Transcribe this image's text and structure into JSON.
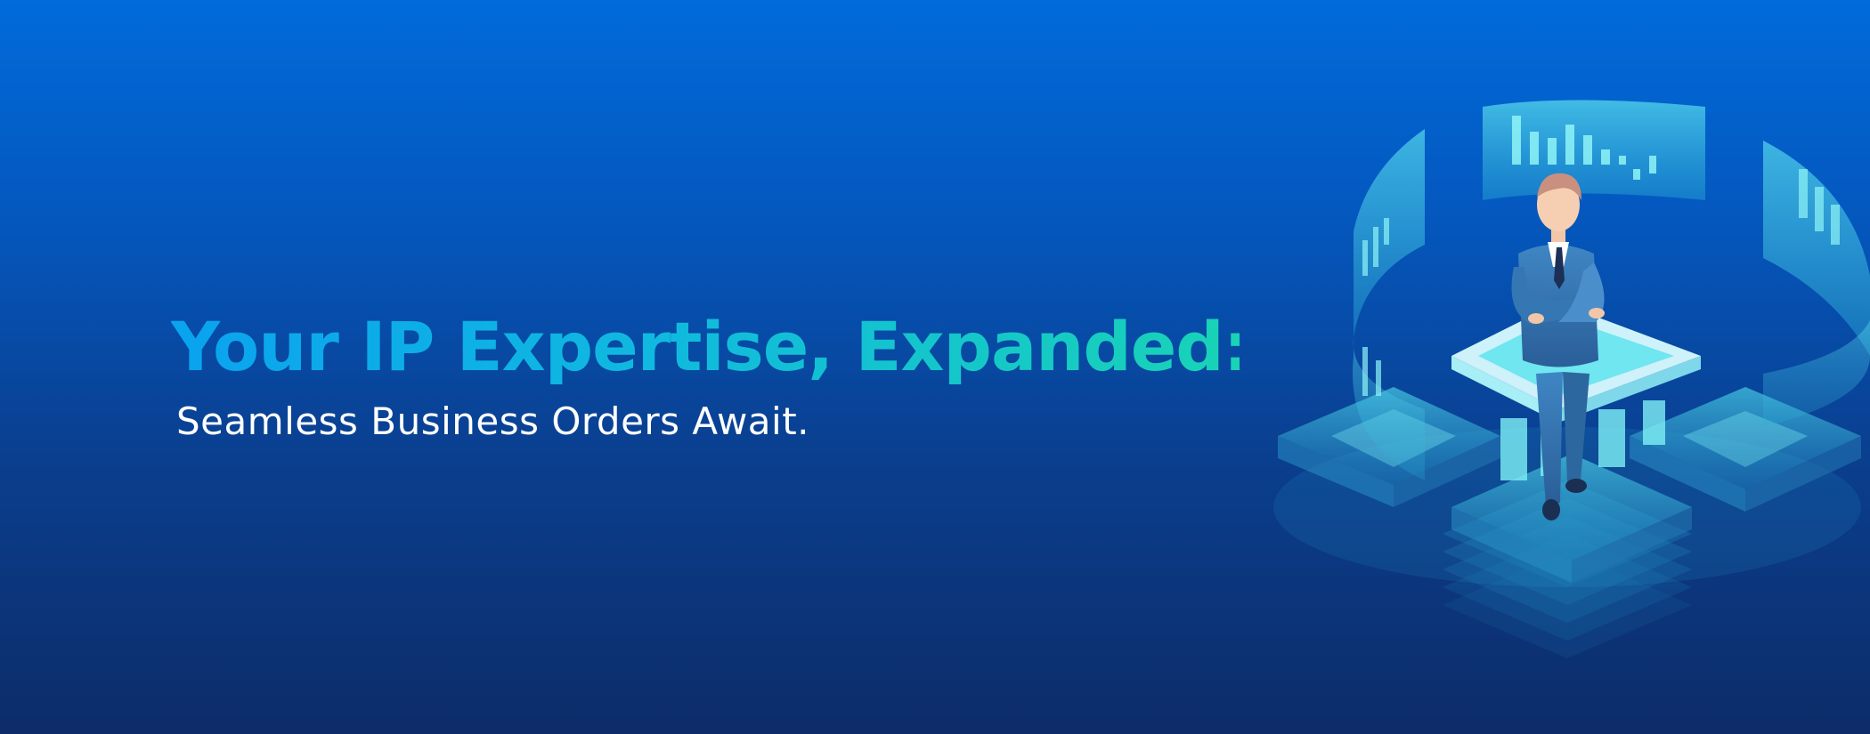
{
  "banner": {
    "headline": "Your IP Expertise, Expanded:",
    "subheadline": "Seamless Business Orders Await."
  },
  "illustration": {
    "icon": "businessman-holographic-dashboard-icon"
  },
  "colors": {
    "background_top": "#016bdb",
    "background_bottom": "#0d2c68",
    "headline_start": "#0aa3ef",
    "headline_end": "#19d3b6",
    "subheadline": "#ffffff",
    "hologram": "#3fd6e6"
  }
}
